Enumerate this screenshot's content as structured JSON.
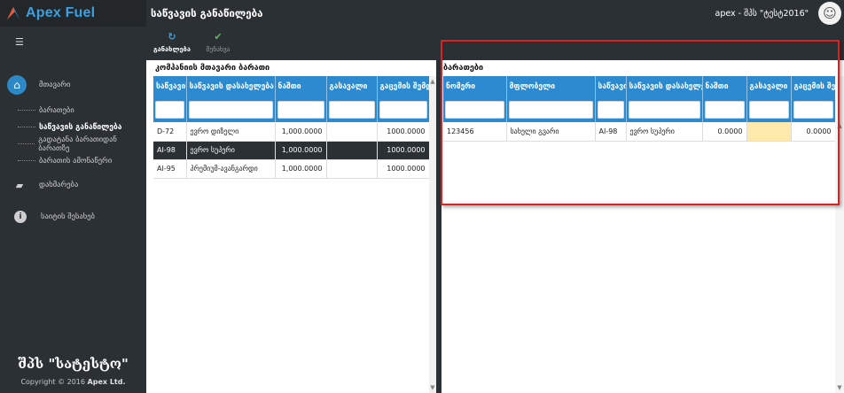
{
  "app": {
    "brand": "Apex Fuel",
    "page_title": "საწვავის განაწილება",
    "user_label": "apex - შპს \"ტესტ2016\""
  },
  "sidebar": {
    "main_item": "მთავარი",
    "sub_items": [
      "ბარათები",
      "საწვავის განაწილება",
      "გადატანა ბარათიდან ბარათზე",
      "ბარათის ამონაწერი"
    ],
    "active_sub_index": 1,
    "help_item": "დახმარება",
    "about_item": "საიტის შესახებ",
    "company_name": "შპს \"სატესტო\"",
    "copyright_prefix": "Copyright © 2016",
    "copyright_company": "Apex Ltd."
  },
  "toolbar": {
    "refresh_label": "განახლება",
    "save_label": "შენახვა"
  },
  "left_panel": {
    "title": "კომპანიის მთავარი ბარათი",
    "columns": [
      "საწვავის",
      "საწვავის დასახელება",
      "ნაშთი",
      "გასავალი",
      "გაცემის შემდ"
    ],
    "rows": [
      {
        "code": "D-72",
        "name": "ევრო დიზელი",
        "balance": "1,000.0000",
        "outflow": "",
        "after": "1000.0000"
      },
      {
        "code": "AI-98",
        "name": "ევრო სუპერი",
        "balance": "1,000.0000",
        "outflow": "",
        "after": "1000.0000"
      },
      {
        "code": "AI-95",
        "name": "პრემიუმ-ავანგარდი",
        "balance": "1,000.0000",
        "outflow": "",
        "after": "1000.0000"
      }
    ],
    "selected_row_index": 1
  },
  "right_panel": {
    "title": "ბარათები",
    "columns": [
      "ნომერი",
      "მფლობელი",
      "საწვავის",
      "საწვავის დასახელე",
      "ნაშთი",
      "გასავალი",
      "გაცემის შე"
    ],
    "rows": [
      {
        "number": "123456",
        "owner": "სახელი გვარი",
        "code": "AI-98",
        "name": "ევრო სუპერი",
        "balance": "0.0000",
        "outflow": "",
        "after": "0.0000"
      }
    ]
  },
  "colors": {
    "dark": "#2b3034",
    "header_blue": "#2d8ad0",
    "accent": "#3aa0e0",
    "highlight": "#e02020",
    "edit_cell": "#fde9a9"
  },
  "icons": {
    "menu": "hamburger-icon",
    "home": "home-icon",
    "help": "chat-icon",
    "about": "info-icon",
    "refresh": "refresh-icon",
    "save": "check-icon",
    "avatar": "user-avatar-icon"
  }
}
